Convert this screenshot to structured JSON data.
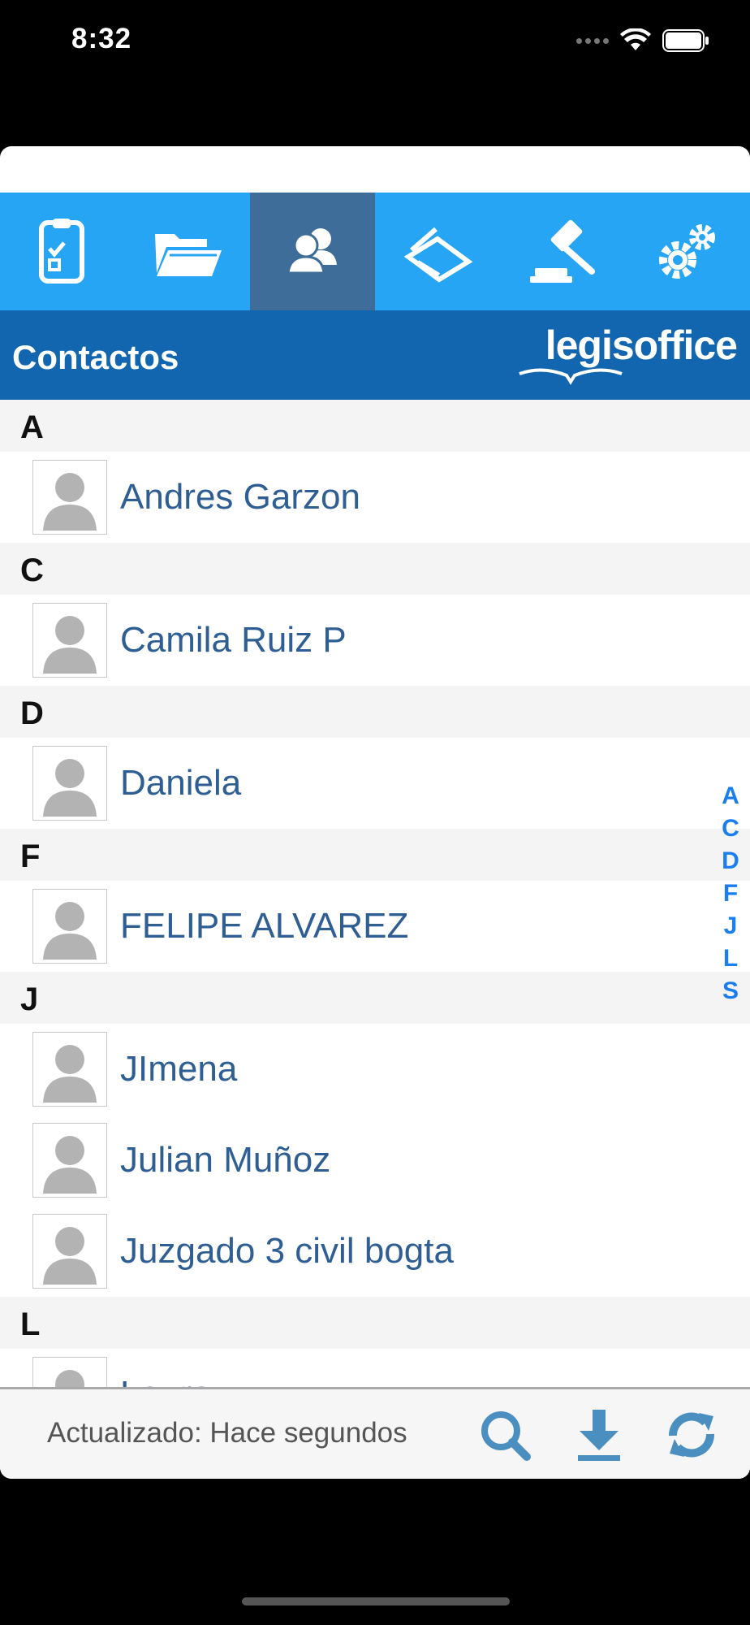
{
  "status": {
    "time": "8:32"
  },
  "toolbar": {
    "tabs": [
      {
        "icon": "tasks-checklist-icon",
        "active": false
      },
      {
        "icon": "folder-icon",
        "active": false
      },
      {
        "icon": "contacts-icon",
        "active": true
      },
      {
        "icon": "scanner-icon",
        "active": false
      },
      {
        "icon": "gavel-icon",
        "active": false
      },
      {
        "icon": "settings-gears-icon",
        "active": false
      }
    ]
  },
  "header": {
    "title": "Contactos",
    "brand": "legisoffice"
  },
  "sections": [
    {
      "letter": "A",
      "contacts": [
        "Andres Garzon"
      ]
    },
    {
      "letter": "C",
      "contacts": [
        "Camila Ruiz P"
      ]
    },
    {
      "letter": "D",
      "contacts": [
        "Daniela"
      ]
    },
    {
      "letter": "F",
      "contacts": [
        "FELIPE ALVAREZ"
      ]
    },
    {
      "letter": "J",
      "contacts": [
        "JImena",
        "Julian Muñoz",
        "Juzgado 3 civil bogta"
      ]
    },
    {
      "letter": "L",
      "contacts": [
        "Laura"
      ]
    }
  ],
  "index": [
    "A",
    "C",
    "D",
    "F",
    "J",
    "L",
    "S"
  ],
  "footer": {
    "updated": "Actualizado: Hace segundos"
  },
  "colors": {
    "toolbar": "#27a5f5",
    "toolbar_active": "#3d6d98",
    "header": "#1266b0",
    "name": "#2e5e94",
    "index": "#1a7ef0",
    "footer_icon": "#4a8fbf"
  }
}
